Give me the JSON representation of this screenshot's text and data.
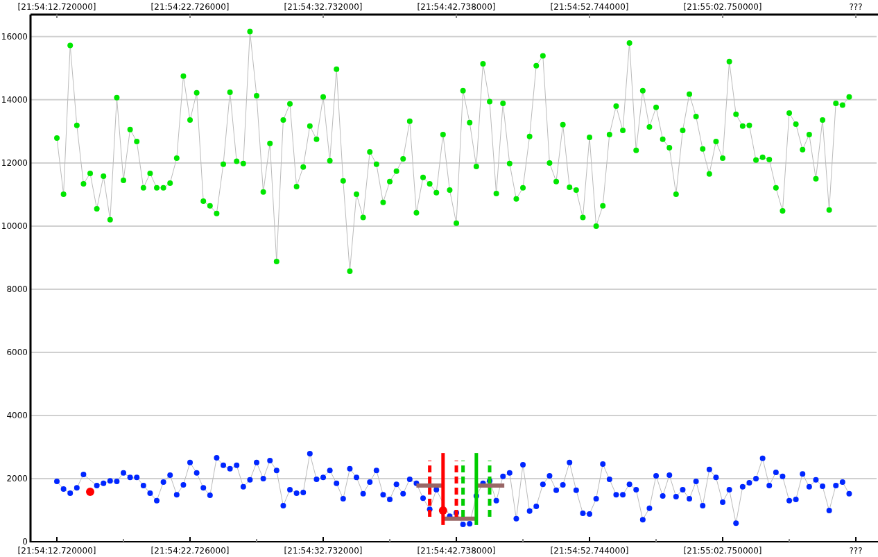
{
  "chart": {
    "chart_data": {
      "type": "line",
      "grid": true,
      "ylim": [
        0,
        16700
      ],
      "categories": [
        "[21:54:12.720000]",
        null,
        null,
        null,
        null,
        null,
        null,
        null,
        null,
        null,
        null,
        null,
        null,
        null,
        null,
        null,
        null,
        null,
        null,
        null,
        "[21:54:22.726000]",
        null,
        null,
        null,
        null,
        null,
        null,
        null,
        null,
        null,
        null,
        null,
        null,
        null,
        null,
        null,
        null,
        null,
        null,
        null,
        "[21:54:32.732000]",
        null,
        null,
        null,
        null,
        null,
        null,
        null,
        null,
        null,
        null,
        null,
        null,
        null,
        null,
        null,
        null,
        null,
        null,
        null,
        "[21:54:42.738000]",
        null,
        null,
        null,
        null,
        null,
        null,
        null,
        null,
        null,
        null,
        null,
        null,
        null,
        null,
        null,
        null,
        null,
        null,
        null,
        "[21:54:52.744000]",
        null,
        null,
        null,
        null,
        null,
        null,
        null,
        null,
        null,
        null,
        null,
        null,
        null,
        null,
        null,
        null,
        null,
        null,
        null,
        "[21:55:02.750000]",
        null,
        null,
        null,
        null,
        null,
        null,
        null,
        null,
        null,
        null,
        null,
        null,
        null,
        null,
        null,
        null,
        null,
        null,
        null,
        "???"
      ],
      "yticks": [
        0,
        2000,
        4000,
        6000,
        8000,
        10000,
        12000,
        14000,
        16000
      ],
      "series": [
        {
          "color": "#00e600",
          "marker": true,
          "values": [
            12790,
            11010,
            15720,
            13190,
            11340,
            11670,
            10550,
            11580,
            10200,
            14070,
            11450,
            13060,
            12680,
            11210,
            11670,
            11210,
            11210,
            11360,
            12150,
            14750,
            13360,
            14220,
            10790,
            10640,
            10400,
            11960,
            14240,
            12050,
            11980,
            16160,
            14130,
            11080,
            12620,
            8880,
            13360,
            13870,
            11250,
            11870,
            13170,
            12750,
            14090,
            12070,
            14970,
            11430,
            8570,
            11010,
            10270,
            12350,
            11960,
            10750,
            11410,
            11740,
            12130,
            13320,
            10420,
            11540,
            11340,
            11060,
            12900,
            11140,
            10090,
            14290,
            13280,
            11890,
            15140,
            13940,
            11030,
            13890,
            11980,
            10860,
            11210,
            12840,
            15080,
            15390,
            12000,
            11410,
            13210,
            11230,
            11140,
            10270,
            12810,
            10000,
            10640,
            12900,
            13800,
            13030,
            15800,
            12400,
            14290,
            13140,
            13760,
            12750,
            12480,
            11010,
            13030,
            14180,
            13470,
            12440,
            11650,
            12680,
            12150,
            15210,
            13540,
            13170,
            13190,
            12090,
            12180,
            12110,
            11210,
            10480,
            13580,
            13230,
            12420,
            12900,
            11500,
            13360,
            10510,
            13890,
            13830,
            14090,
            null
          ]
        },
        {
          "color": "#0026ff",
          "marker": true,
          "values": [
            1910,
            1670,
            1540,
            1710,
            2130,
            null,
            1780,
            1850,
            1930,
            1910,
            2180,
            2040,
            2040,
            1780,
            1540,
            1300,
            1890,
            2110,
            1490,
            1800,
            2510,
            2180,
            1710,
            1470,
            2660,
            2420,
            2310,
            2420,
            1740,
            1960,
            2510,
            2000,
            2570,
            2260,
            1140,
            1650,
            1540,
            1560,
            2790,
            1980,
            2040,
            2260,
            1850,
            1360,
            2310,
            2040,
            1520,
            1890,
            2260,
            1490,
            1340,
            1820,
            1520,
            1980,
            1850,
            1380,
            1030,
            1650,
            null,
            810,
            920,
            550,
            570,
            1450,
            1850,
            1930,
            1300,
            2070,
            2180,
            730,
            2440,
            970,
            1120,
            1820,
            2090,
            1630,
            1800,
            2510,
            1630,
            900,
            880,
            1360,
            2460,
            1980,
            1490,
            1490,
            1820,
            1650,
            700,
            1060,
            2090,
            1450,
            2110,
            1430,
            1650,
            1360,
            1910,
            1140,
            2290,
            2040,
            1250,
            1650,
            590,
            1740,
            1870,
            2000,
            2640,
            1780,
            2200,
            2070,
            1300,
            1340,
            2150,
            1740,
            1960,
            1760,
            990,
            1780,
            1890,
            1520,
            null
          ]
        }
      ]
    }
  }
}
